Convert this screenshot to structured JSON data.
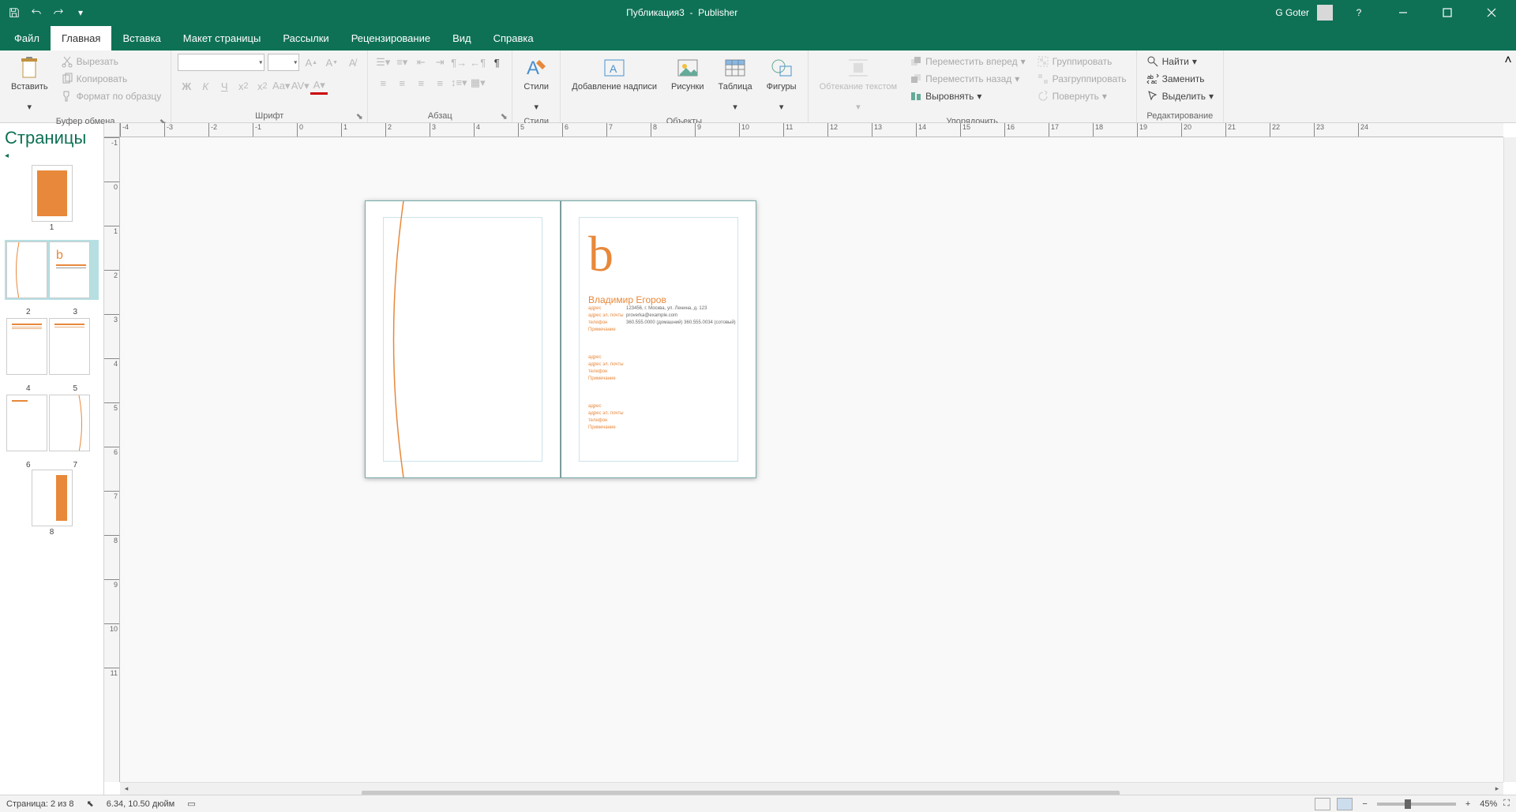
{
  "titlebar": {
    "doc_title": "Публикация3",
    "app_name": "Publisher",
    "user": "G Goter"
  },
  "tabs": {
    "file": "Файл",
    "home": "Главная",
    "insert": "Вставка",
    "layout": "Макет страницы",
    "mailings": "Рассылки",
    "review": "Рецензирование",
    "view": "Вид",
    "help": "Справка"
  },
  "ribbon": {
    "paste": "Вставить",
    "cut": "Вырезать",
    "copy": "Копировать",
    "format_painter": "Формат по образцу",
    "clipboard_label": "Буфер обмена",
    "font_label": "Шрифт",
    "paragraph_label": "Абзац",
    "styles": "Стили",
    "styles_label": "Стили",
    "textbox": "Добавление надписи",
    "pictures": "Рисунки",
    "table": "Таблица",
    "shapes": "Фигуры",
    "objects_label": "Объекты",
    "wrap": "Обтекание текстом",
    "bring_fwd": "Переместить вперед",
    "send_back": "Переместить назад",
    "align": "Выровнять",
    "group": "Группировать",
    "ungroup": "Разгруппировать",
    "rotate": "Повернуть",
    "arrange_label": "Упорядочить",
    "find": "Найти",
    "replace": "Заменить",
    "select": "Выделить",
    "edit_label": "Редактирование"
  },
  "pages_panel": {
    "title": "Страницы",
    "numbers": [
      "1",
      "2",
      "3",
      "4",
      "5",
      "6",
      "7",
      "8"
    ]
  },
  "document": {
    "big_letter": "b",
    "name": "Владимир Егоров",
    "fields": {
      "address_label": "адрес",
      "email_label": "адрес эл. почты",
      "phone_label": "телефон",
      "notes_label": "Примечание",
      "address_val": "123456, г. Москва, ул. Ленина, д. 123",
      "email_val": "proverka@example.com",
      "phone_val": "360.555.0000 (домашний) 360.555.0034 (сотовый)"
    }
  },
  "statusbar": {
    "page": "Страница: 2 из 8",
    "coords": "6.34, 10.50 дюйм",
    "zoom": "45%"
  },
  "ruler_h": [
    "-4",
    "-3",
    "-2",
    "-1",
    "0",
    "1",
    "2",
    "3",
    "4",
    "5",
    "6",
    "7",
    "8",
    "9",
    "10",
    "11",
    "12",
    "13",
    "14",
    "15",
    "16",
    "17",
    "18",
    "19",
    "20",
    "21",
    "22",
    "23",
    "24"
  ],
  "ruler_v": [
    "-1",
    "0",
    "1",
    "2",
    "3",
    "4",
    "5",
    "6",
    "7",
    "8",
    "9",
    "10",
    "11"
  ]
}
